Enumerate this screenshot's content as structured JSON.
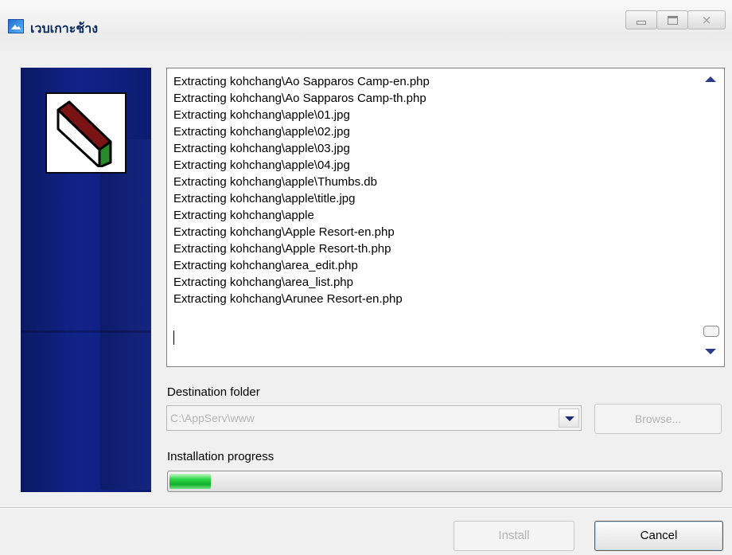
{
  "window": {
    "title": "เวบเกาะช้าง",
    "controls": [
      "minimize",
      "maximize",
      "close"
    ],
    "close_glyph": "⨯"
  },
  "log": {
    "lines": [
      "Extracting kohchang\\Ao Sapparos Camp-en.php",
      "Extracting kohchang\\Ao Sapparos Camp-th.php",
      "Extracting kohchang\\apple\\01.jpg",
      "Extracting kohchang\\apple\\02.jpg",
      "Extracting kohchang\\apple\\03.jpg",
      "Extracting kohchang\\apple\\04.jpg",
      "Extracting kohchang\\apple\\Thumbs.db",
      "Extracting kohchang\\apple\\title.jpg",
      "Extracting kohchang\\apple",
      "Extracting kohchang\\Apple Resort-en.php",
      "Extracting kohchang\\Apple Resort-th.php",
      "Extracting kohchang\\area_edit.php",
      "Extracting kohchang\\area_list.php",
      "Extracting kohchang\\Arunee Resort-en.php"
    ]
  },
  "destination": {
    "label": "Destination folder",
    "value": "C:\\AppServ\\www",
    "browse_label": "Browse..."
  },
  "progress": {
    "label": "Installation progress",
    "value": 0.075,
    "color": "#22c43a"
  },
  "buttons": {
    "install_label": "Install",
    "cancel_label": "Cancel"
  },
  "colors": {
    "sidebar": "#0f2180",
    "box_top": "#7a1414",
    "box_side": "#2a8a2a",
    "box_front": "#ffffff"
  }
}
